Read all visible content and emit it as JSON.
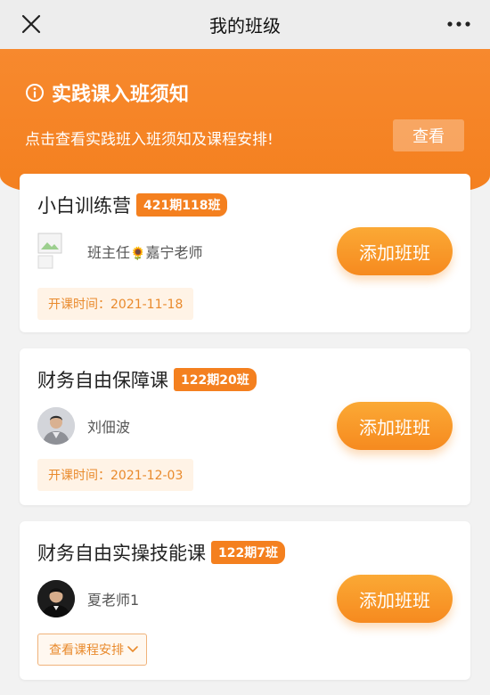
{
  "nav": {
    "title": "我的班级"
  },
  "banner": {
    "title": "实践课入班须知",
    "description": "点击查看实践班入班须知及课程安排!",
    "button_label": "查看"
  },
  "cards": [
    {
      "title": "小白训练营",
      "period": "421期118班",
      "teacher_prefix": "班主任",
      "teacher_emoji": "🌻",
      "teacher_name": "嘉宁老师",
      "add_label": "添加班班",
      "start_time": "开课时间：2021-11-18"
    },
    {
      "title": "财务自由保障课",
      "period": "122期20班",
      "teacher_name": "刘佃波",
      "add_label": "添加班班",
      "start_time": "开课时间：2021-12-03"
    },
    {
      "title": "财务自由实操技能课",
      "period": "122期7班",
      "teacher_name": "夏老师1",
      "add_label": "添加班班",
      "schedule_label": "查看课程安排"
    }
  ],
  "colors": {
    "accent": "#f4801f",
    "tag_bg": "#fff3e6",
    "tag_text": "#e98a2c"
  }
}
